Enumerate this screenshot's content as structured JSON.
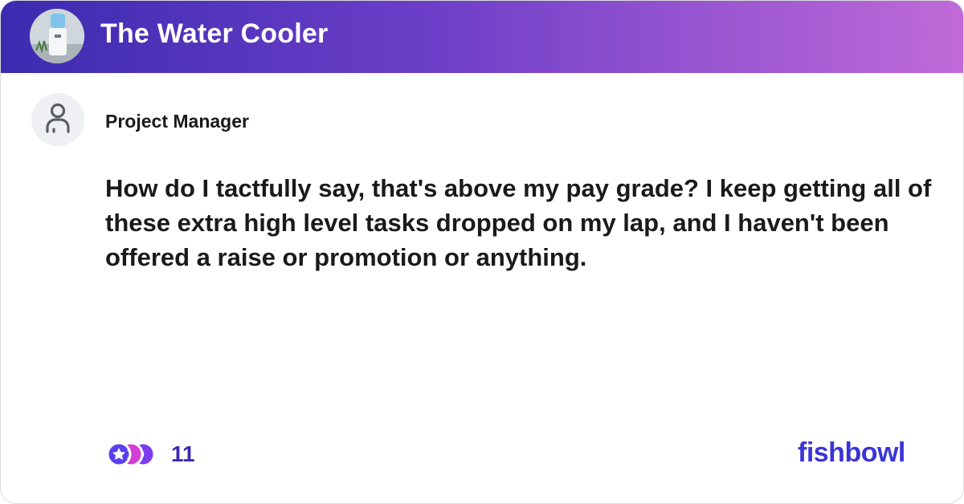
{
  "header": {
    "group_title": "The Water Cooler",
    "group_avatar_icon": "water-cooler-photo",
    "gradient_start": "#3b2bb0",
    "gradient_end": "#c06ad8"
  },
  "post": {
    "author": "Project Manager",
    "author_avatar_icon": "user-icon",
    "body": "How do I tactfully say, that's above my pay grade? I keep getting all of these extra high level tasks dropped on my lap, and I haven't been offered a raise or promotion or anything."
  },
  "footer": {
    "reactions_icon": "reaction-emojis-icon",
    "reaction_count": "11",
    "brand": "fishbowl",
    "brand_color": "#3b35d6"
  }
}
